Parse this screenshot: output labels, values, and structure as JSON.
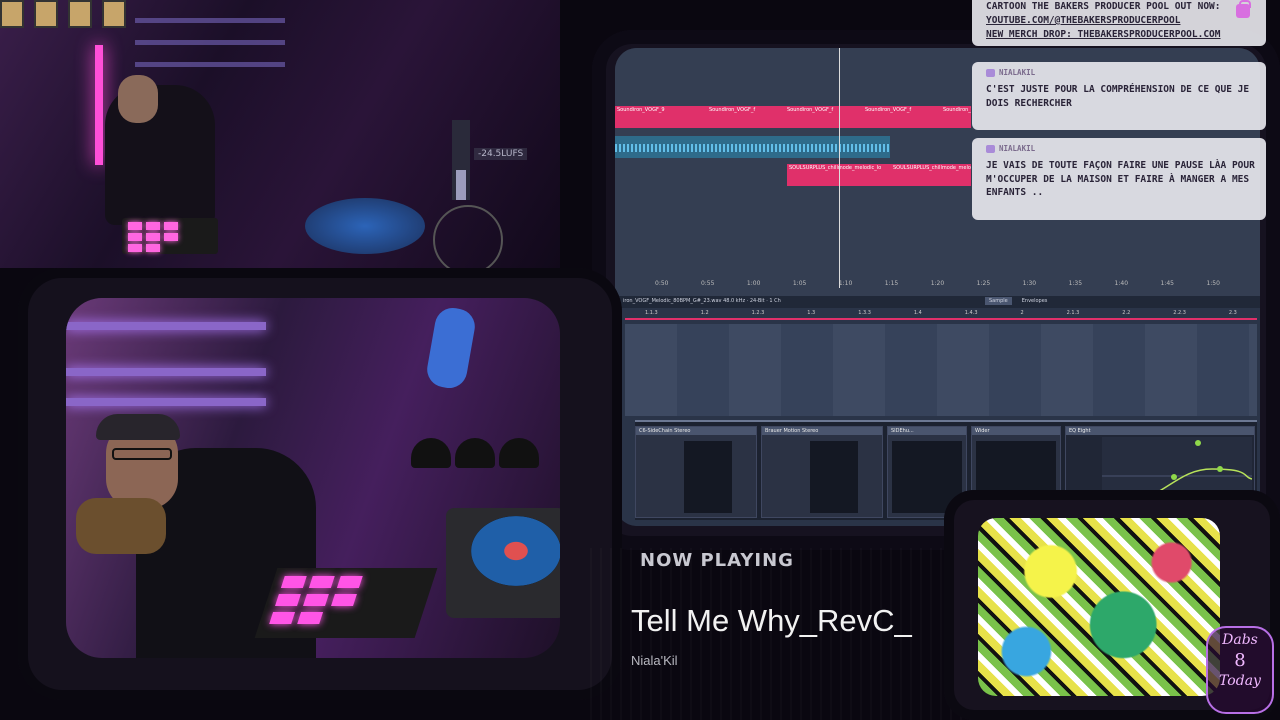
{
  "overlay": {
    "lufs_readout": "-24.5LUFS"
  },
  "daw": {
    "clips_row1": [
      "Soundiron_VOGF_9",
      "Soundiron_VOGF_f",
      "Soundiron_VOGF_f",
      "Soundiron_VOGF_f",
      "Soundiron_VOGF_f"
    ],
    "clips_row3": [
      "SOULSURPLUS_chillmode_melodic_lo",
      "SOULSURPLUS_chillmode_melodic"
    ],
    "timeline": [
      "0:50",
      "0:55",
      "1:00",
      "1:05",
      "1:10",
      "1:15",
      "1:20",
      "1:25",
      "1:30",
      "1:35",
      "1:40",
      "1:45",
      "1:50"
    ],
    "clip_info": "iron_VOGF_Melodic_80BPM_G#_23.wav  48.0 kHz · 24-Bit · 1 Ch",
    "detail_tabs": [
      "Sample",
      "Envelopes"
    ],
    "ruler2": [
      "1.1.3",
      "1.2",
      "1.2.3",
      "1.3",
      "1.3.3",
      "1.4",
      "1.4.3",
      "2",
      "2.1.3",
      "2.2",
      "2.2.3",
      "2.3"
    ],
    "devices": [
      "C6-SideChain Stereo",
      "Brauer Motion Stereo",
      "SIDEhu...",
      "Wider"
    ],
    "eq_title": "EQ Eight",
    "accent_pink": "#e0306a",
    "accent_blue": "#2e6b8a"
  },
  "chat": {
    "messages": [
      {
        "user": "",
        "lines": [
          "CARTOON THE BAKERS PRODUCER POOL OUT NOW:",
          "YOUTUBE.COM/@THEBAKERSPRODUCERPOOL",
          "NEW MERCH DROP: THEBAKERSPRODUCERPOOL.COM"
        ]
      },
      {
        "user": "NIALAKIL",
        "text": "C'EST JUSTE POUR LA COMPRÉHENSION DE CE QUE JE DOIS RECHERCHER"
      },
      {
        "user": "NIALAKIL",
        "text": "JE VAIS DE TOUTE FAÇON FAIRE UNE PAUSE LÀA POUR M'OCCUPER DE LA MAISON ET FAIRE À MANGER A MES ENFANTS .."
      }
    ]
  },
  "now_playing": {
    "label": "NOW PLAYING",
    "title": "Tell Me Why_RevC_",
    "artist": "Niala'Kil"
  },
  "logo": {
    "line1": "Dabs",
    "line2": "8",
    "line3": "Today"
  }
}
